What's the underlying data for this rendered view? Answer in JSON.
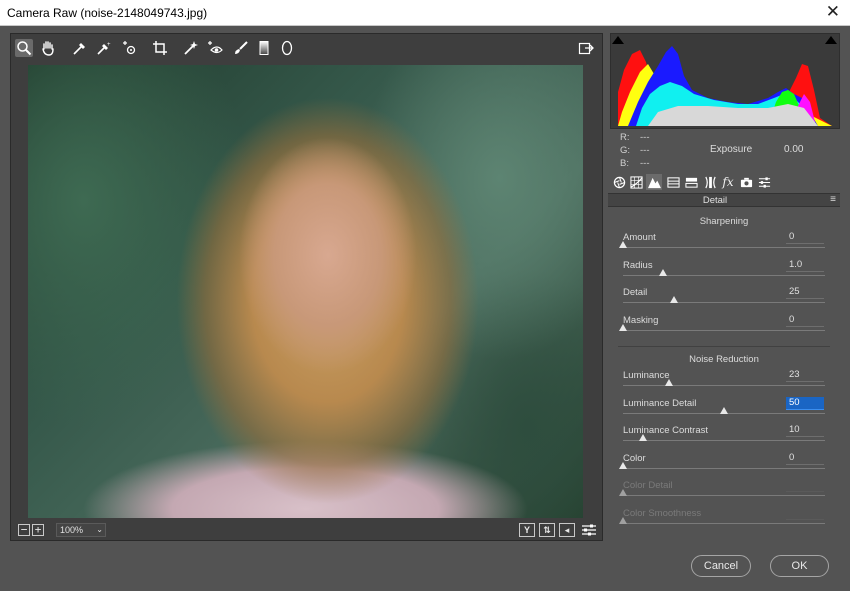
{
  "window": {
    "title": "Camera Raw (noise-2148049743.jpg)"
  },
  "toolbar": {
    "tools": [
      "zoom-tool",
      "hand-tool",
      "white-balance-tool",
      "color-sampler-tool",
      "targeted-adjustment-tool",
      "crop-tool",
      "straighten-tool",
      "spot-removal-tool",
      "red-eye-tool",
      "adjustment-brush",
      "graduated-filter",
      "radial-filter"
    ]
  },
  "footer": {
    "zoom": "100%"
  },
  "readout": {
    "r_label": "R:",
    "r_value": "---",
    "g_label": "G:",
    "g_value": "---",
    "b_label": "B:",
    "b_value": "---",
    "exposure_label": "Exposure",
    "exposure_value": "0.00"
  },
  "panel": {
    "title": "Detail",
    "sharpening_title": "Sharpening",
    "noise_title": "Noise Reduction",
    "sharpening": [
      {
        "label": "Amount",
        "value": "0",
        "level": 0
      },
      {
        "label": "Radius",
        "value": "1.0",
        "level": 0.2
      },
      {
        "label": "Detail",
        "value": "25",
        "level": 0.25
      },
      {
        "label": "Masking",
        "value": "0",
        "level": 0
      }
    ],
    "noise": [
      {
        "label": "Luminance",
        "value": "23",
        "level": 0.23
      },
      {
        "label": "Luminance Detail",
        "value": "50",
        "level": 0.5
      },
      {
        "label": "Luminance Contrast",
        "value": "10",
        "level": 0.1
      },
      {
        "label": "Color",
        "value": "0",
        "level": 0
      },
      {
        "label": "Color Detail",
        "value": "",
        "level": 0
      },
      {
        "label": "Color Smoothness",
        "value": "",
        "level": 0
      }
    ]
  },
  "buttons": {
    "cancel": "Cancel",
    "ok": "OK"
  },
  "colors": {
    "accent": "#1a65c4",
    "background": "#535353",
    "panel": "#3e3e3e"
  }
}
